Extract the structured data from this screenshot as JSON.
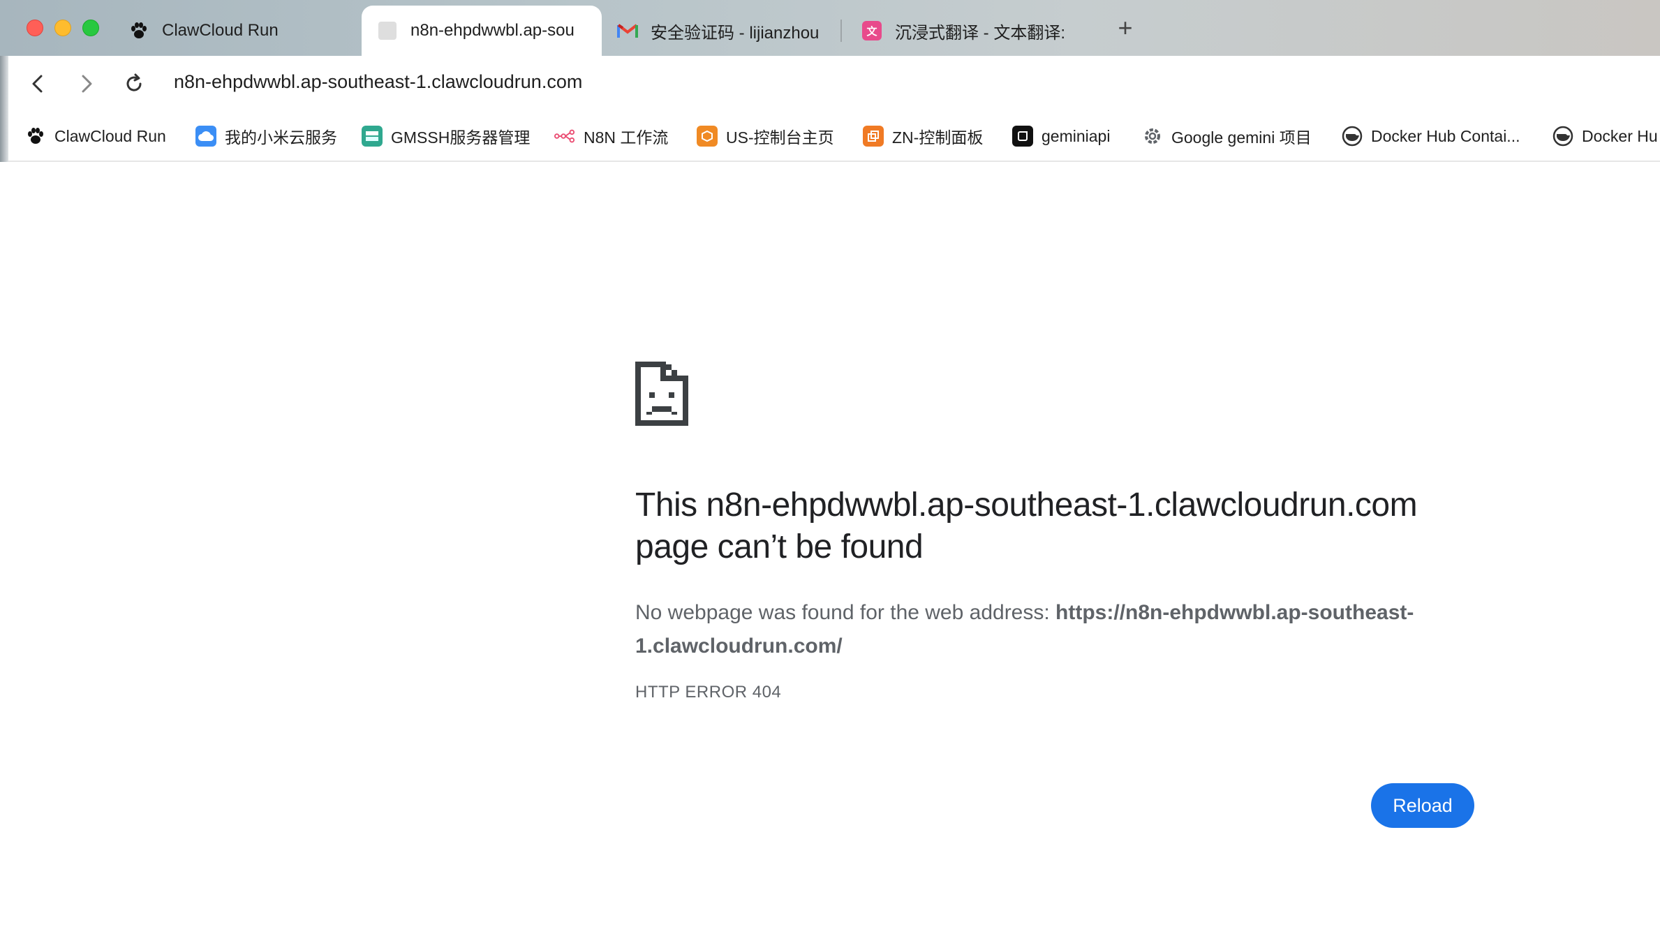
{
  "browser": {
    "tabs": [
      {
        "title": "ClawCloud Run",
        "icon": "paw-icon",
        "active": false
      },
      {
        "title": "n8n-ehpdwwbl.ap-sou",
        "icon": "blank-page-icon",
        "active": true
      },
      {
        "title": "安全验证码 - lijianzhou",
        "icon": "gmail-icon",
        "active": false
      },
      {
        "title": "沉浸式翻译 - 文本翻译:",
        "icon": "translate-icon",
        "active": false
      }
    ],
    "new_tab_label": "+",
    "address_bar": {
      "url": "n8n-ehpdwwbl.ap-southeast-1.clawcloudrun.com"
    },
    "bookmarks": [
      {
        "label": "ClawCloud Run",
        "icon": "paw-icon"
      },
      {
        "label": "我的小米云服务",
        "icon": "cloud-icon",
        "color": "#3b8ef5"
      },
      {
        "label": "GMSSH服务器管理",
        "icon": "server-icon",
        "color": "#2fa88f"
      },
      {
        "label": "N8N 工作流",
        "icon": "workflow-icon",
        "color": "#ea4b71"
      },
      {
        "label": "US-控制台主页",
        "icon": "box-icon",
        "color": "#f08a24"
      },
      {
        "label": "ZN-控制面板",
        "icon": "copy-icon",
        "color": "#f07a24"
      },
      {
        "label": "geminiapi",
        "icon": "app-icon",
        "color": "#111111"
      },
      {
        "label": "Google gemini 项目",
        "icon": "gear-icon",
        "color": "#5f6368"
      },
      {
        "label": "Docker Hub Contai...",
        "icon": "docker-icon",
        "color": "#1d63ed"
      },
      {
        "label": "Docker Hu",
        "icon": "docker-icon",
        "color": "#1d63ed"
      }
    ]
  },
  "error_page": {
    "icon": "sad-document-icon",
    "title": "This n8n-ehpdwwbl.ap-southeast-1.clawcloudrun.com page can’t be found",
    "desc_prefix": "No webpage was found for the web address: ",
    "desc_url": "https://n8n-ehpdwwbl.ap-southeast-1.clawcloudrun.com/",
    "error_code": "HTTP ERROR 404",
    "reload_label": "Reload"
  },
  "colors": {
    "accent": "#1a73e8",
    "title_text": "#202124",
    "secondary_text": "#5f6368"
  }
}
